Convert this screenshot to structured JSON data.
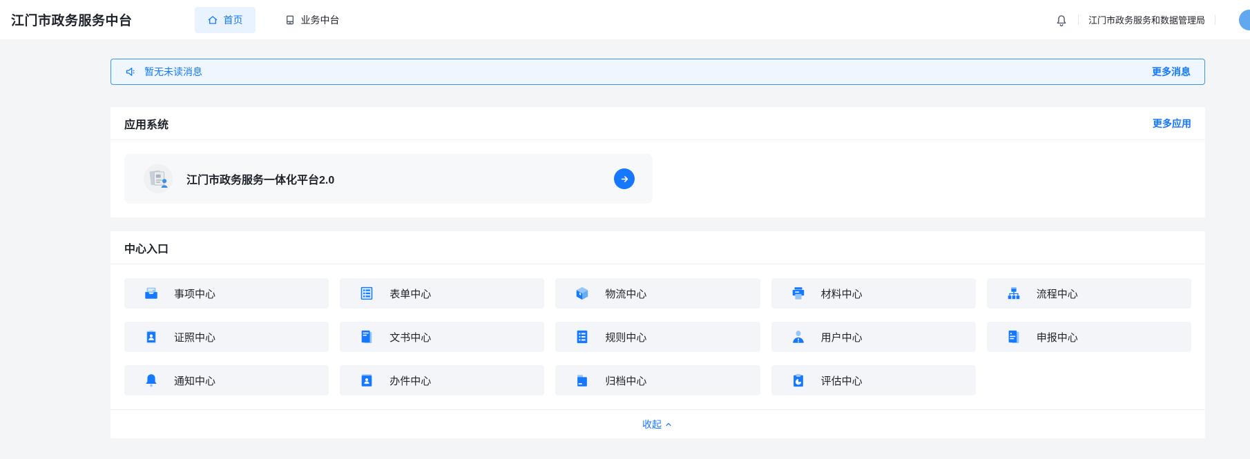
{
  "colors": {
    "primary": "#1677ff",
    "tab_active_bg": "#e8f3ff",
    "notice_bg": "#eef7ff",
    "notice_border": "#3b94e8",
    "card_bg": "#ffffff",
    "page_bg": "#f4f5f7"
  },
  "header": {
    "brand": "江门市政务服务中台",
    "tabs": [
      {
        "label": "首页",
        "icon": "home-icon",
        "active": true
      },
      {
        "label": "业务中台",
        "icon": "platform-icon",
        "active": false
      }
    ],
    "org_name": "江门市政务服务和数据管理局"
  },
  "notice_bar": {
    "text": "暂无未读消息",
    "more_label": "更多消息"
  },
  "app_section": {
    "title": "应用系统",
    "more_label": "更多应用",
    "apps": [
      {
        "name": "江门市政务服务一体化平台2.0"
      }
    ]
  },
  "center_section": {
    "title": "中心入口",
    "collapse_label": "收起",
    "centers": [
      {
        "label": "事项中心",
        "icon": "inbox-icon"
      },
      {
        "label": "表单中心",
        "icon": "form-icon"
      },
      {
        "label": "物流中心",
        "icon": "cube-icon"
      },
      {
        "label": "材料中心",
        "icon": "printer-icon"
      },
      {
        "label": "流程中心",
        "icon": "sitemap-icon"
      },
      {
        "label": "证照中心",
        "icon": "id-badge-icon"
      },
      {
        "label": "文书中心",
        "icon": "book-icon"
      },
      {
        "label": "规则中心",
        "icon": "list-icon"
      },
      {
        "label": "用户中心",
        "icon": "user-icon"
      },
      {
        "label": "申报中心",
        "icon": "report-icon"
      },
      {
        "label": "通知中心",
        "icon": "bell-filled-icon"
      },
      {
        "label": "办件中心",
        "icon": "case-icon"
      },
      {
        "label": "归档中心",
        "icon": "folder-icon"
      },
      {
        "label": "评估中心",
        "icon": "clipboard-icon"
      }
    ]
  }
}
